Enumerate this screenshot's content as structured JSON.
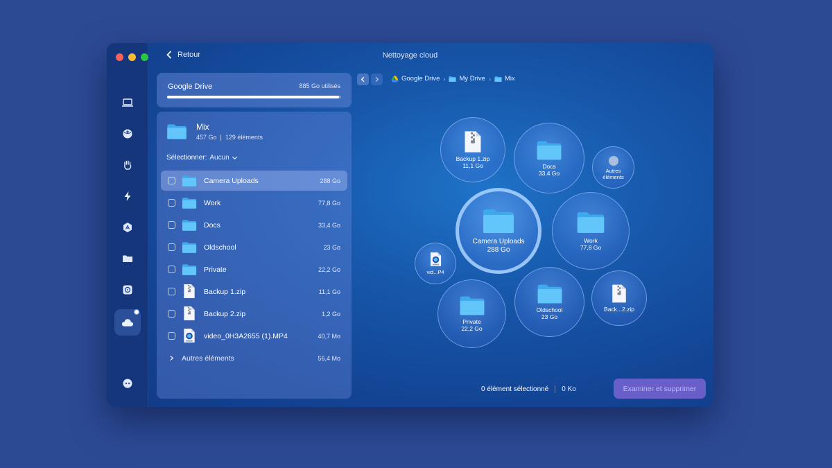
{
  "window": {
    "title": "Nettoyage cloud",
    "back_label": "Retour"
  },
  "drive": {
    "name": "Google Drive",
    "used": "885 Go utilisés",
    "usage_fraction": 0.99
  },
  "folder": {
    "name": "Mix",
    "size": "457 Go",
    "separator": "|",
    "count": "129 éléments"
  },
  "selector": {
    "label": "Sélectionner:",
    "value": "Aucun"
  },
  "items": [
    {
      "name": "Camera Uploads",
      "size": "288 Go",
      "kind": "folder",
      "highlighted": true
    },
    {
      "name": "Work",
      "size": "77,8 Go",
      "kind": "folder"
    },
    {
      "name": "Docs",
      "size": "33,4 Go",
      "kind": "folder"
    },
    {
      "name": "Oldschool",
      "size": "23 Go",
      "kind": "folder"
    },
    {
      "name": "Private",
      "size": "22,2 Go",
      "kind": "folder"
    },
    {
      "name": "Backup 1.zip",
      "size": "11,1 Go",
      "kind": "zip"
    },
    {
      "name": "Backup 2.zip",
      "size": "1,2 Go",
      "kind": "zip"
    },
    {
      "name": "video_0H3A2655 (1).MP4",
      "size": "40,7 Mo",
      "kind": "video"
    }
  ],
  "other_items": {
    "name": "Autres éléments",
    "size": "56,4 Mo"
  },
  "breadcrumb": {
    "items": [
      "Google Drive",
      "My Drive",
      "Mix"
    ],
    "separator": "›"
  },
  "bubbles": [
    {
      "name": "Backup 1.zip",
      "size": "11,1 Go",
      "icon": "zip-icon"
    },
    {
      "name": "Docs",
      "size": "33,4 Go",
      "icon": "folder-icon"
    },
    {
      "name": "Autres",
      "name2": "éléments",
      "icon": "dot-icon"
    },
    {
      "name": "Camera Uploads",
      "size": "288 Go",
      "icon": "folder-icon"
    },
    {
      "name": "Work",
      "size": "77,8 Go",
      "icon": "folder-icon"
    },
    {
      "name": "vid...P4",
      "icon": "video-icon"
    },
    {
      "name": "Private",
      "size": "22,2 Go",
      "icon": "folder-icon"
    },
    {
      "name": "Oldschool",
      "size": "23 Go",
      "icon": "folder-icon"
    },
    {
      "name": "Back...2.zip",
      "icon": "zip-icon"
    }
  ],
  "status": {
    "selected": "0 élément sélectionné",
    "size": "0 Ko"
  },
  "action": {
    "label": "Examiner et supprimer"
  },
  "zip_label": "ZIP",
  "colors": {
    "background": "#2c4a94",
    "folder": "#5cc0f5",
    "accent_button": "#966ee6"
  }
}
